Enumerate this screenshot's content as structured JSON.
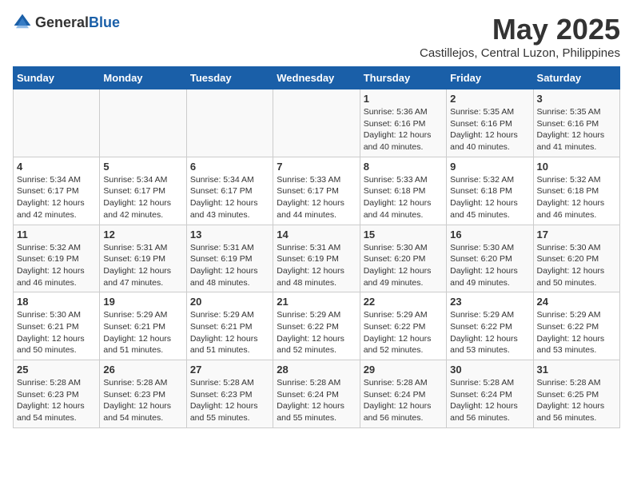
{
  "logo": {
    "general": "General",
    "blue": "Blue"
  },
  "header": {
    "title": "May 2025",
    "subtitle": "Castillejos, Central Luzon, Philippines"
  },
  "weekdays": [
    "Sunday",
    "Monday",
    "Tuesday",
    "Wednesday",
    "Thursday",
    "Friday",
    "Saturday"
  ],
  "weeks": [
    [
      {
        "day": "",
        "info": ""
      },
      {
        "day": "",
        "info": ""
      },
      {
        "day": "",
        "info": ""
      },
      {
        "day": "",
        "info": ""
      },
      {
        "day": "1",
        "info": "Sunrise: 5:36 AM\nSunset: 6:16 PM\nDaylight: 12 hours\nand 40 minutes."
      },
      {
        "day": "2",
        "info": "Sunrise: 5:35 AM\nSunset: 6:16 PM\nDaylight: 12 hours\nand 40 minutes."
      },
      {
        "day": "3",
        "info": "Sunrise: 5:35 AM\nSunset: 6:16 PM\nDaylight: 12 hours\nand 41 minutes."
      }
    ],
    [
      {
        "day": "4",
        "info": "Sunrise: 5:34 AM\nSunset: 6:17 PM\nDaylight: 12 hours\nand 42 minutes."
      },
      {
        "day": "5",
        "info": "Sunrise: 5:34 AM\nSunset: 6:17 PM\nDaylight: 12 hours\nand 42 minutes."
      },
      {
        "day": "6",
        "info": "Sunrise: 5:34 AM\nSunset: 6:17 PM\nDaylight: 12 hours\nand 43 minutes."
      },
      {
        "day": "7",
        "info": "Sunrise: 5:33 AM\nSunset: 6:17 PM\nDaylight: 12 hours\nand 44 minutes."
      },
      {
        "day": "8",
        "info": "Sunrise: 5:33 AM\nSunset: 6:18 PM\nDaylight: 12 hours\nand 44 minutes."
      },
      {
        "day": "9",
        "info": "Sunrise: 5:32 AM\nSunset: 6:18 PM\nDaylight: 12 hours\nand 45 minutes."
      },
      {
        "day": "10",
        "info": "Sunrise: 5:32 AM\nSunset: 6:18 PM\nDaylight: 12 hours\nand 46 minutes."
      }
    ],
    [
      {
        "day": "11",
        "info": "Sunrise: 5:32 AM\nSunset: 6:19 PM\nDaylight: 12 hours\nand 46 minutes."
      },
      {
        "day": "12",
        "info": "Sunrise: 5:31 AM\nSunset: 6:19 PM\nDaylight: 12 hours\nand 47 minutes."
      },
      {
        "day": "13",
        "info": "Sunrise: 5:31 AM\nSunset: 6:19 PM\nDaylight: 12 hours\nand 48 minutes."
      },
      {
        "day": "14",
        "info": "Sunrise: 5:31 AM\nSunset: 6:19 PM\nDaylight: 12 hours\nand 48 minutes."
      },
      {
        "day": "15",
        "info": "Sunrise: 5:30 AM\nSunset: 6:20 PM\nDaylight: 12 hours\nand 49 minutes."
      },
      {
        "day": "16",
        "info": "Sunrise: 5:30 AM\nSunset: 6:20 PM\nDaylight: 12 hours\nand 49 minutes."
      },
      {
        "day": "17",
        "info": "Sunrise: 5:30 AM\nSunset: 6:20 PM\nDaylight: 12 hours\nand 50 minutes."
      }
    ],
    [
      {
        "day": "18",
        "info": "Sunrise: 5:30 AM\nSunset: 6:21 PM\nDaylight: 12 hours\nand 50 minutes."
      },
      {
        "day": "19",
        "info": "Sunrise: 5:29 AM\nSunset: 6:21 PM\nDaylight: 12 hours\nand 51 minutes."
      },
      {
        "day": "20",
        "info": "Sunrise: 5:29 AM\nSunset: 6:21 PM\nDaylight: 12 hours\nand 51 minutes."
      },
      {
        "day": "21",
        "info": "Sunrise: 5:29 AM\nSunset: 6:22 PM\nDaylight: 12 hours\nand 52 minutes."
      },
      {
        "day": "22",
        "info": "Sunrise: 5:29 AM\nSunset: 6:22 PM\nDaylight: 12 hours\nand 52 minutes."
      },
      {
        "day": "23",
        "info": "Sunrise: 5:29 AM\nSunset: 6:22 PM\nDaylight: 12 hours\nand 53 minutes."
      },
      {
        "day": "24",
        "info": "Sunrise: 5:29 AM\nSunset: 6:22 PM\nDaylight: 12 hours\nand 53 minutes."
      }
    ],
    [
      {
        "day": "25",
        "info": "Sunrise: 5:28 AM\nSunset: 6:23 PM\nDaylight: 12 hours\nand 54 minutes."
      },
      {
        "day": "26",
        "info": "Sunrise: 5:28 AM\nSunset: 6:23 PM\nDaylight: 12 hours\nand 54 minutes."
      },
      {
        "day": "27",
        "info": "Sunrise: 5:28 AM\nSunset: 6:23 PM\nDaylight: 12 hours\nand 55 minutes."
      },
      {
        "day": "28",
        "info": "Sunrise: 5:28 AM\nSunset: 6:24 PM\nDaylight: 12 hours\nand 55 minutes."
      },
      {
        "day": "29",
        "info": "Sunrise: 5:28 AM\nSunset: 6:24 PM\nDaylight: 12 hours\nand 56 minutes."
      },
      {
        "day": "30",
        "info": "Sunrise: 5:28 AM\nSunset: 6:24 PM\nDaylight: 12 hours\nand 56 minutes."
      },
      {
        "day": "31",
        "info": "Sunrise: 5:28 AM\nSunset: 6:25 PM\nDaylight: 12 hours\nand 56 minutes."
      }
    ]
  ]
}
